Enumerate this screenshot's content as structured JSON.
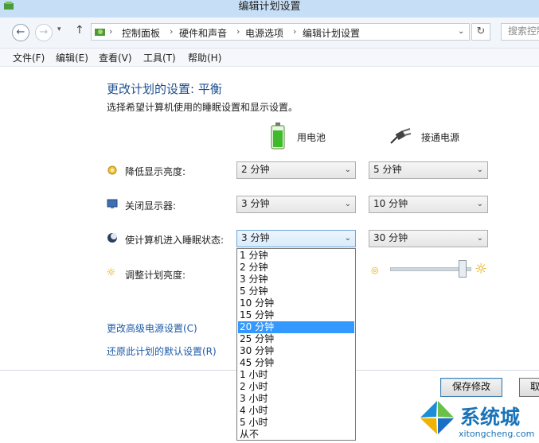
{
  "window": {
    "title": "编辑计划设置"
  },
  "nav": {
    "back_icon": "arrow-left-icon",
    "forward_icon": "arrow-right-icon",
    "breadcrumbs": [
      "控制面板",
      "硬件和声音",
      "电源选项",
      "编辑计划设置"
    ],
    "search_placeholder": "搜索控制"
  },
  "menu": [
    "文件(F)",
    "编辑(E)",
    "查看(V)",
    "工具(T)",
    "帮助(H)"
  ],
  "page": {
    "heading": "更改计划的设置: 平衡",
    "subheading": "选择希望计算机使用的睡眠设置和显示设置。",
    "col_battery": "用电池",
    "col_plugged": "接通电源"
  },
  "rows": [
    {
      "label": "降低显示亮度:",
      "battery": "2 分钟",
      "plugged": "5 分钟",
      "icon": "dim-display-icon"
    },
    {
      "label": "关闭显示器:",
      "battery": "3 分钟",
      "plugged": "10 分钟",
      "icon": "display-off-icon"
    },
    {
      "label": "使计算机进入睡眠状态:",
      "battery": "3 分钟",
      "plugged": "30 分钟",
      "icon": "sleep-icon"
    },
    {
      "label": "调整计划亮度:",
      "icon": "brightness-icon"
    }
  ],
  "dropdown_options": [
    "1 分钟",
    "2 分钟",
    "3 分钟",
    "5 分钟",
    "10 分钟",
    "15 分钟",
    "20 分钟",
    "25 分钟",
    "30 分钟",
    "45 分钟",
    "1 小时",
    "2 小时",
    "3 小时",
    "4 小时",
    "5 小时",
    "从不"
  ],
  "dropdown_highlight": "20 分钟",
  "links": {
    "advanced": "更改高级电源设置(C)",
    "restore": "还原此计划的默认设置(R)"
  },
  "buttons": {
    "save": "保存修改",
    "cancel": "取"
  },
  "watermark": {
    "brand": "系统城",
    "url": "xitongcheng.com"
  },
  "colors": {
    "link": "#1b5aa6",
    "heading": "#1f4f8e",
    "selection": "#3399ff"
  }
}
